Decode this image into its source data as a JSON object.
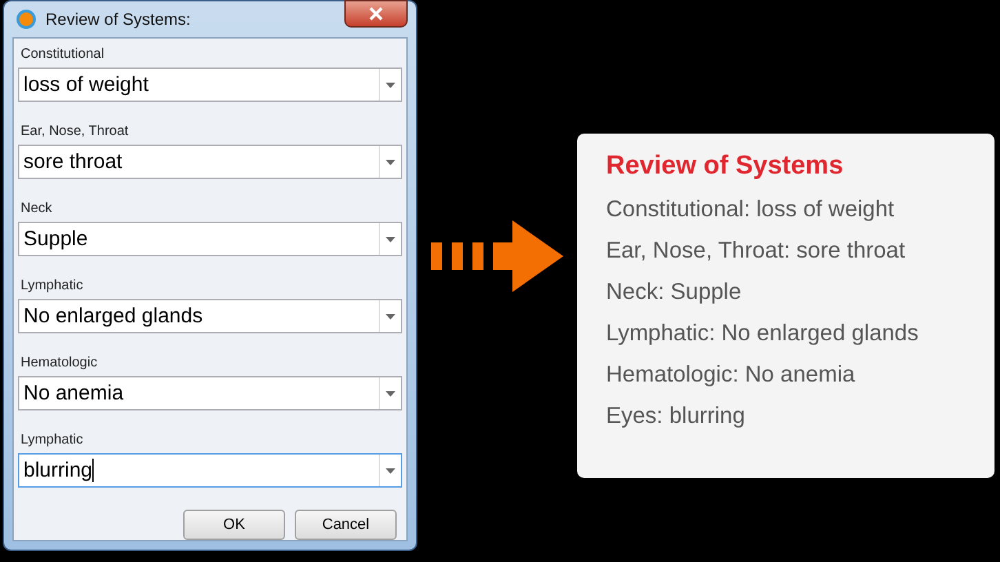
{
  "dialog": {
    "title": "Review of Systems:",
    "fields": [
      {
        "label": "Constitutional",
        "value": "loss of weight",
        "focused": false
      },
      {
        "label": "Ear, Nose, Throat",
        "value": "sore throat",
        "focused": false
      },
      {
        "label": "Neck",
        "value": "Supple",
        "focused": false
      },
      {
        "label": "Lymphatic",
        "value": "No enlarged glands",
        "focused": false
      },
      {
        "label": "Hematologic",
        "value": "No anemia",
        "focused": false
      },
      {
        "label": "Lymphatic",
        "value": "blurring",
        "focused": true
      }
    ],
    "buttons": [
      "OK",
      "Cancel"
    ]
  },
  "summary": {
    "title": "Review of Systems",
    "lines": [
      "Constitutional: loss of weight",
      "Ear, Nose, Throat: sore throat",
      "Neck: Supple",
      "Lymphatic: No enlarged glands",
      "Hematologic: No anemia",
      "Eyes: blurring"
    ]
  }
}
